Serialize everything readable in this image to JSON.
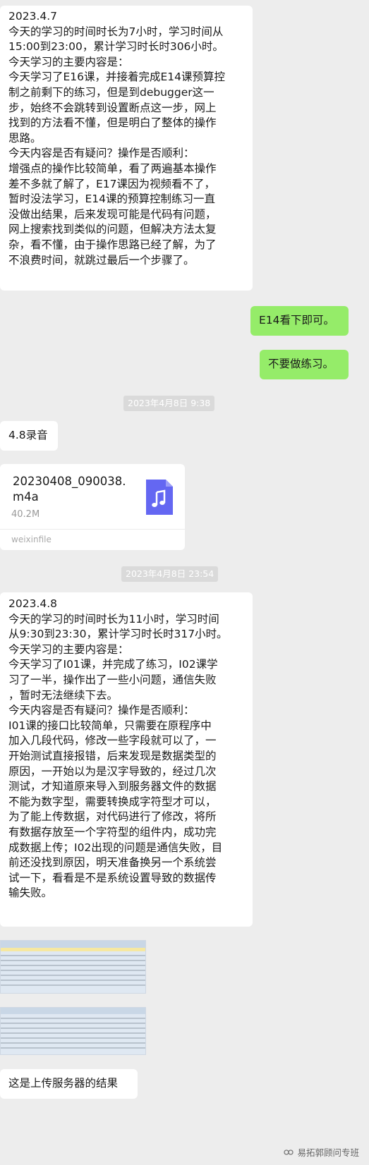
{
  "messages": {
    "m1": {
      "lines": [
        "2023.4.7",
        "今天的学习的时间时长为7小时，学习时间从",
        "15:00到23:00，累计学习时长时306小时。",
        "今天学习的主要内容是：",
        "今天学习了E16课，并接着完成E14课预算控",
        "制之前剩下的练习，但是到debugger这一",
        "步，始终不会跳转到设置断点这一步，网上",
        "找到的方法看不懂，但是明白了整体的操作",
        "思路。",
        "今天内容是否有疑问？操作是否顺利：",
        " 增强点的操作比较简单，看了两遍基本操作",
        "差不多就了解了，E17课因为视频看不了，",
        "暂时没法学习，E14课的预算控制练习一直",
        "没做出结果，后来发现可能是代码有问题，",
        "网上搜索找到类似的问题，但解决方法太复",
        "杂，看不懂，由于操作思路已经了解，为了",
        "不浪费时间，就跳过最后一个步骤了。"
      ]
    },
    "reply1": "E14看下即可。",
    "reply2": "不要做练习。",
    "timestamp1": "2023年4月8日 9:38",
    "m2": "4.8录音",
    "file": {
      "name_line1": "20230408_090038.",
      "name_line2": "m4a",
      "size": "40.2M",
      "source": "weixinfile",
      "icon": "music-note-icon"
    },
    "timestamp2": "2023年4月8日 23:54",
    "m3": {
      "lines": [
        "2023.4.8",
        "今天的学习的时间时长为11小时，学习时间",
        "从9:30到23:30，累计学习时长时317小时。",
        "今天学习的主要内容是：",
        "今天学习了I01课，并完成了练习，I02课学",
        "习了一半，操作出了一些小问题，通信失败",
        "，暂时无法继续下去。",
        "今天内容是否有疑问？操作是否顺利：",
        " I01课的接口比较简单，只需要在原程序中",
        "加入几段代码，修改一些字段就可以了，一",
        "开始测试直接报错，后来发现是数据类型的",
        "原因，一开始以为是汉字导致的，经过几次",
        "测试，才知道原来导入到服务器文件的数据",
        "不能为数字型，需要转换成字符型才可以，",
        "为了能上传数据，对代码进行了修改，将所",
        "有数据存放至一个字符型的组件内，成功完",
        "成数据上传；I02出现的问题是通信失败，目",
        "前还没找到原因，明天准备换另一个系统尝",
        "试一下，看看是不是系统设置导致的数据传",
        "输失败。"
      ]
    },
    "m4": "这是上传服务器的结果"
  },
  "watermark": {
    "text": "易拓郭顾问专班",
    "icon": "wechat-channel-icon"
  },
  "colors": {
    "background": "#ededed",
    "bubble_left": "#ffffff",
    "bubble_right": "#95ec69",
    "file_icon": "#6467f2"
  }
}
